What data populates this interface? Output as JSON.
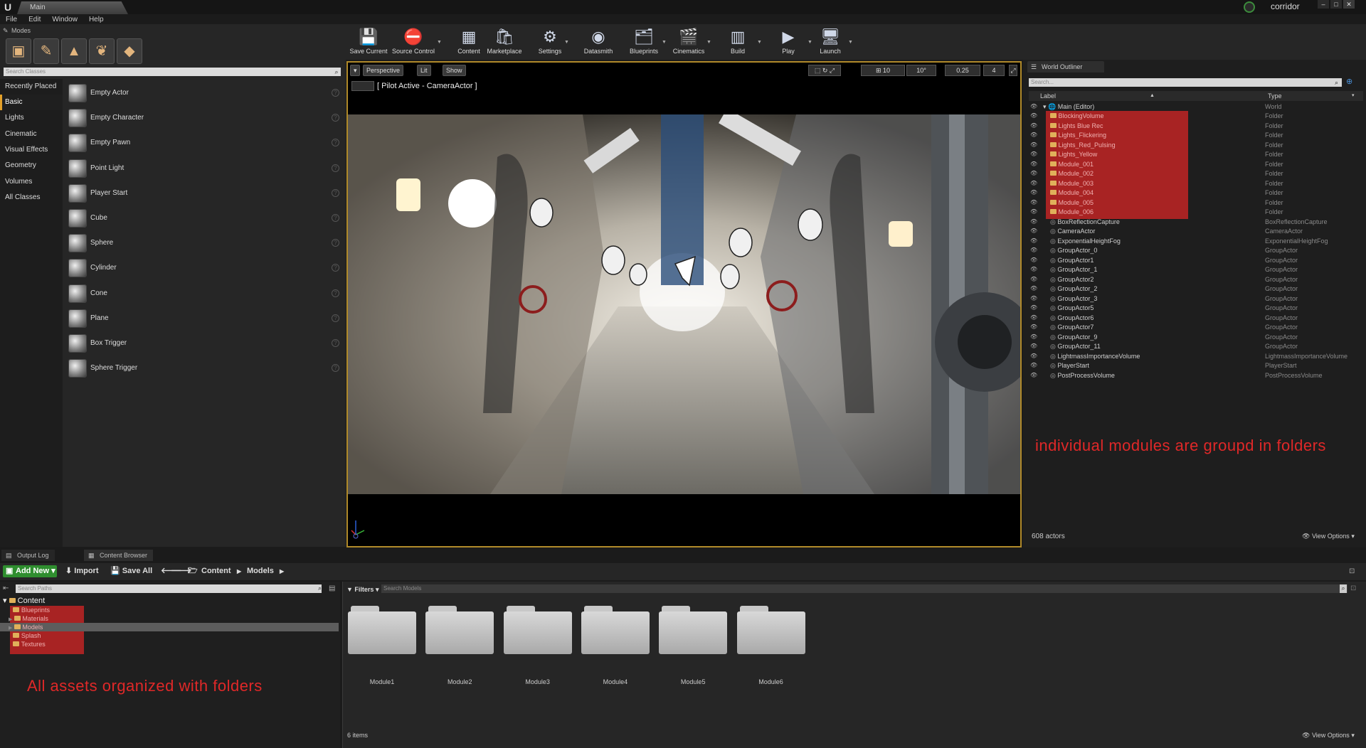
{
  "title_bar": {
    "map_tab": "Main",
    "project": "corridor"
  },
  "menu": [
    "File",
    "Edit",
    "Window",
    "Help"
  ],
  "modes": {
    "tab_label": "Modes",
    "search_placeholder": "Search Classes",
    "categories": [
      "Recently Placed",
      "Basic",
      "Lights",
      "Cinematic",
      "Visual Effects",
      "Geometry",
      "Volumes",
      "All Classes"
    ],
    "selected_category": "Basic",
    "items": [
      "Empty Actor",
      "Empty Character",
      "Empty Pawn",
      "Point Light",
      "Player Start",
      "Cube",
      "Sphere",
      "Cylinder",
      "Cone",
      "Plane",
      "Box Trigger",
      "Sphere Trigger"
    ]
  },
  "toolbar": {
    "buttons": [
      "Save Current",
      "Source Control",
      "Content",
      "Marketplace",
      "Settings",
      "Datasmith",
      "Blueprints",
      "Cinematics",
      "Build",
      "Play",
      "Launch"
    ]
  },
  "viewport": {
    "perspective": "Perspective",
    "lit": "Lit",
    "show": "Show",
    "pilot_label": "[ Pilot Active - CameraActor ]",
    "grid_snap": "10",
    "rotation_snap": "10°",
    "scale_snap": "0.25",
    "camera_speed": "4"
  },
  "outliner": {
    "tab_label": "World Outliner",
    "search_placeholder": "Search...",
    "col_label": "Label",
    "col_type": "Type",
    "root": {
      "label": "Main (Editor)",
      "type": "World"
    },
    "rows": [
      {
        "label": "BlockingVolume",
        "type": "Folder"
      },
      {
        "label": "Lights Blue Rec",
        "type": "Folder"
      },
      {
        "label": "Lights_Flickering",
        "type": "Folder"
      },
      {
        "label": "Lights_Red_Pulsing",
        "type": "Folder"
      },
      {
        "label": "Lights_Yellow",
        "type": "Folder"
      },
      {
        "label": "Module_001",
        "type": "Folder"
      },
      {
        "label": "Module_002",
        "type": "Folder"
      },
      {
        "label": "Module_003",
        "type": "Folder"
      },
      {
        "label": "Module_004",
        "type": "Folder"
      },
      {
        "label": "Module_005",
        "type": "Folder"
      },
      {
        "label": "Module_006",
        "type": "Folder"
      },
      {
        "label": "BoxReflectionCapture",
        "type": "BoxReflectionCapture"
      },
      {
        "label": "CameraActor",
        "type": "CameraActor"
      },
      {
        "label": "ExponentialHeightFog",
        "type": "ExponentialHeightFog"
      },
      {
        "label": "GroupActor_0",
        "type": "GroupActor"
      },
      {
        "label": "GroupActor1",
        "type": "GroupActor"
      },
      {
        "label": "GroupActor_1",
        "type": "GroupActor"
      },
      {
        "label": "GroupActor2",
        "type": "GroupActor"
      },
      {
        "label": "GroupActor_2",
        "type": "GroupActor"
      },
      {
        "label": "GroupActor_3",
        "type": "GroupActor"
      },
      {
        "label": "GroupActor5",
        "type": "GroupActor"
      },
      {
        "label": "GroupActor6",
        "type": "GroupActor"
      },
      {
        "label": "GroupActor7",
        "type": "GroupActor"
      },
      {
        "label": "GroupActor_9",
        "type": "GroupActor"
      },
      {
        "label": "GroupActor_11",
        "type": "GroupActor"
      },
      {
        "label": "LightmassImportanceVolume",
        "type": "LightmassImportanceVolume"
      },
      {
        "label": "PlayerStart",
        "type": "PlayerStart"
      },
      {
        "label": "PostProcessVolume",
        "type": "PostProcessVolume"
      }
    ],
    "annotation": "individual modules are groupd in folders",
    "actor_count": "608 actors",
    "view_options": "View Options"
  },
  "bottom_tabs": [
    "Output Log",
    "Content Browser"
  ],
  "content_browser": {
    "add_new": "Add New",
    "import": "Import",
    "save_all": "Save All",
    "breadcrumb": [
      "Content",
      "Models"
    ],
    "path_search_placeholder": "Search Paths",
    "tree_root": "Content",
    "tree_folders": [
      "Blueprints",
      "Materials",
      "Models",
      "Splash",
      "Textures"
    ],
    "filters": "Filters",
    "asset_search_placeholder": "Search Models",
    "assets": [
      "Module1",
      "Module2",
      "Module3",
      "Module4",
      "Module5",
      "Module6"
    ],
    "annotation": "All assets organized with folders",
    "item_count": "6 items",
    "view_options": "View Options"
  },
  "colors": {
    "accent": "#e3a029",
    "annotation_red": "#e02828",
    "highlight_red": "#b32424",
    "add_new_green": "#2f8e2f"
  }
}
